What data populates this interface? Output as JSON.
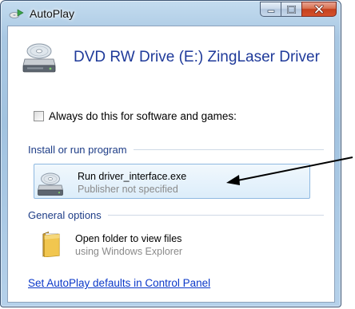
{
  "window": {
    "title": "AutoPlay",
    "title_icon": "autoplay-icon",
    "buttons": {
      "minimize_icon": "minimize-icon",
      "maximize_icon": "maximize-icon",
      "close_icon": "close-icon"
    }
  },
  "device": {
    "icon": "dvd-drive-icon",
    "title": "DVD RW Drive (E:) ZingLaser Driver"
  },
  "always_checkbox": {
    "label": "Always do this for software and games:",
    "checked": false
  },
  "sections": {
    "install": {
      "header": "Install or run program",
      "options": [
        {
          "icon": "dvd-drive-icon",
          "title": "Run driver_interface.exe",
          "subtitle": "Publisher not specified",
          "selected": true
        }
      ]
    },
    "general": {
      "header": "General options",
      "options": [
        {
          "icon": "folder-icon",
          "title": "Open folder to view files",
          "subtitle": "using Windows Explorer",
          "selected": false
        }
      ]
    }
  },
  "footer_link": "Set AutoPlay defaults in Control Panel",
  "annotation": {
    "icon": "arrow-annotation",
    "color": "#000000"
  },
  "colors": {
    "title_text": "#1f3a9a",
    "section_header": "#1e3d87",
    "link": "#0b38c9",
    "subtitle_gray": "#8a8a8a"
  }
}
